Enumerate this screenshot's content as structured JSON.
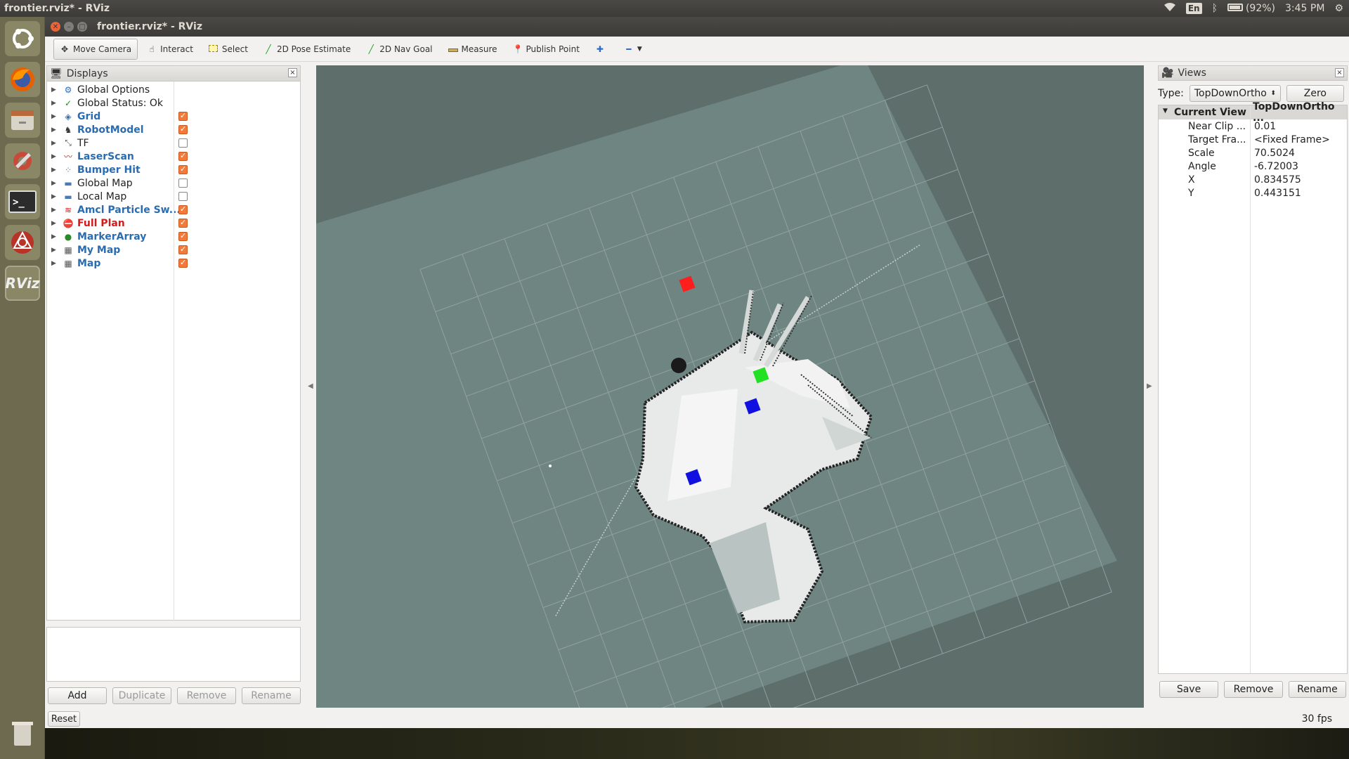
{
  "topbar": {
    "window_title": "frontier.rviz* - RViz",
    "lang": "En",
    "battery": "(92%)",
    "time": "3:45 PM"
  },
  "launcher": {
    "items": [
      "ubuntu-dash",
      "firefox",
      "files",
      "system-settings",
      "terminal",
      "ros-app",
      "rviz"
    ],
    "rviz_label": "RViz"
  },
  "window": {
    "title": "frontier.rviz* - RViz"
  },
  "toolbar": {
    "move_camera": "Move Camera",
    "interact": "Interact",
    "select": "Select",
    "pose_estimate": "2D Pose Estimate",
    "nav_goal": "2D Nav Goal",
    "measure": "Measure",
    "publish_point": "Publish Point"
  },
  "displays": {
    "title": "Displays",
    "items": [
      {
        "label": "Global Options",
        "style": "normal",
        "checkbox": null,
        "icon": "gear-icon"
      },
      {
        "label": "Global Status: Ok",
        "style": "normal",
        "checkbox": null,
        "icon": "check-icon"
      },
      {
        "label": "Grid",
        "style": "blue",
        "checkbox": true,
        "icon": "grid-icon"
      },
      {
        "label": "RobotModel",
        "style": "blue",
        "checkbox": true,
        "icon": "robot-icon"
      },
      {
        "label": "TF",
        "style": "normal",
        "checkbox": false,
        "icon": "tf-icon"
      },
      {
        "label": "LaserScan",
        "style": "blue",
        "checkbox": true,
        "icon": "laser-icon"
      },
      {
        "label": "Bumper Hit",
        "style": "blue",
        "checkbox": true,
        "icon": "pointcloud-icon"
      },
      {
        "label": "Global Map",
        "style": "normal",
        "checkbox": false,
        "icon": "folder-icon"
      },
      {
        "label": "Local Map",
        "style": "normal",
        "checkbox": false,
        "icon": "folder-icon"
      },
      {
        "label": "Amcl Particle Sw...",
        "style": "blue",
        "checkbox": true,
        "icon": "pose-array-icon"
      },
      {
        "label": "Full Plan",
        "style": "red",
        "checkbox": true,
        "icon": "error-icon"
      },
      {
        "label": "MarkerArray",
        "style": "blue",
        "checkbox": true,
        "icon": "marker-icon"
      },
      {
        "label": "My Map",
        "style": "blue",
        "checkbox": true,
        "icon": "map-icon"
      },
      {
        "label": "Map",
        "style": "blue",
        "checkbox": true,
        "icon": "map-icon"
      }
    ],
    "buttons": {
      "add": "Add",
      "duplicate": "Duplicate",
      "remove": "Remove",
      "rename": "Rename"
    }
  },
  "views": {
    "title": "Views",
    "type_label": "Type:",
    "type_value": "TopDownOrtho",
    "zero": "Zero",
    "header_name": "Current View",
    "header_value": "TopDownOrtho ...",
    "props": [
      {
        "name": "Near Clip ...",
        "value": "0.01"
      },
      {
        "name": "Target Fra...",
        "value": "<Fixed Frame>"
      },
      {
        "name": "Scale",
        "value": "70.5024"
      },
      {
        "name": "Angle",
        "value": "-6.72003"
      },
      {
        "name": "X",
        "value": "0.834575"
      },
      {
        "name": "Y",
        "value": "0.443151"
      }
    ],
    "buttons": {
      "save": "Save",
      "remove": "Remove",
      "rename": "Rename"
    }
  },
  "status": {
    "reset": "Reset",
    "fps": "30 fps"
  },
  "colors": {
    "viewport_bg": "#5d6e6b",
    "map_unknown": "#6f8582",
    "checkbox_on": "#f47a3a",
    "marker_red": "#ff1e1e",
    "marker_green": "#22e022",
    "marker_blue": "#1010e0"
  }
}
